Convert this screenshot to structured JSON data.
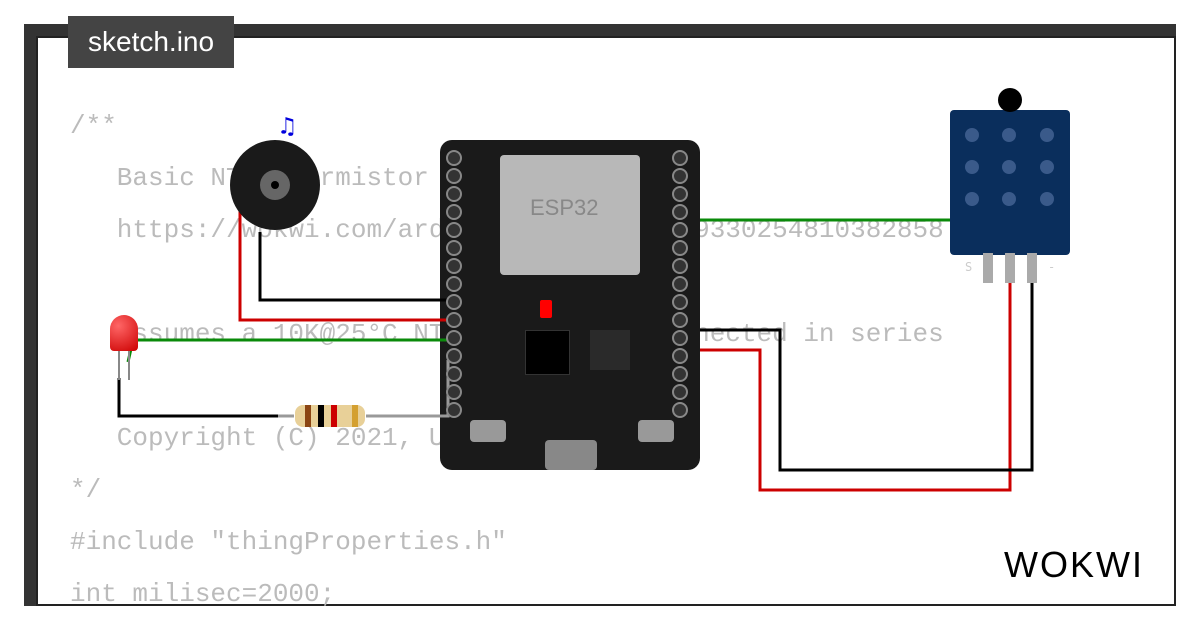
{
  "tab": {
    "filename": "sketch.ino"
  },
  "code": {
    "text": "/**\n   Basic NTC Thermistor demo\n   https://wokwi.com/arduino/projects/299330254810382858\n\n   Assumes a 10K@25°C NTC thermistor connected in series\n\n   Copyright (C) 2021, Uri Shaked\n*/\n#include \"thingProperties.h\"\nint milisec=2000;"
  },
  "brand": {
    "logo": "WOKWI"
  },
  "components": {
    "esp32": {
      "label": "ESP32"
    },
    "buzzer": {
      "icon": "♫"
    },
    "led": {
      "color": "red"
    },
    "resistor": {
      "bands": [
        "brown",
        "black",
        "red",
        "gold"
      ]
    },
    "ntc_module": {
      "pin_labels": {
        "left": "S",
        "middle": "",
        "right": "-"
      }
    }
  },
  "wires": [
    {
      "color": "green",
      "from": "ESP32_GPIO",
      "to": "NTC_S"
    },
    {
      "color": "red",
      "from": "ESP32_3V3",
      "to": "NTC_VCC"
    },
    {
      "color": "black",
      "from": "ESP32_GND",
      "to": "NTC_GND"
    },
    {
      "color": "green",
      "from": "ESP32_GPIO_L",
      "to": "LED_anode"
    },
    {
      "color": "red",
      "from": "ESP32_GPIO_L2",
      "to": "Buzzer_+"
    },
    {
      "color": "black",
      "from": "ESP32_GND_L",
      "to": "Buzzer_-"
    },
    {
      "color": "black",
      "from": "LED_cathode",
      "to": "Resistor_1"
    },
    {
      "color": "silver",
      "from": "Resistor_2",
      "to": "ESP32_GND_L2"
    }
  ]
}
